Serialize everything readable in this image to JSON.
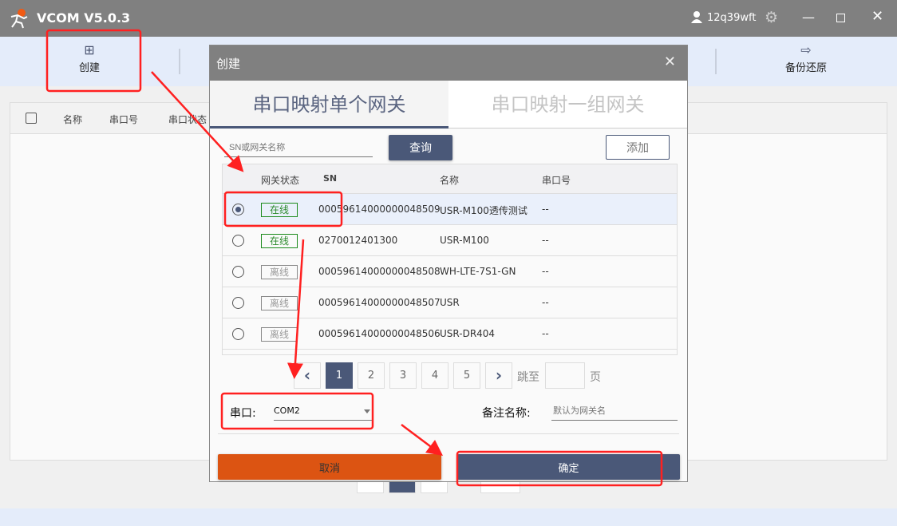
{
  "app": {
    "title": "VCOM V5.0.3",
    "user": "12q39wft"
  },
  "toolbar": {
    "create": "创建",
    "backup": "备份还原"
  },
  "main_table": {
    "headers": [
      "名称",
      "串口号",
      "串口状态"
    ]
  },
  "dialog": {
    "title": "创建",
    "tabs": [
      {
        "label": "串口映射单个网关",
        "active": true
      },
      {
        "label": "串口映射一组网关",
        "active": false
      }
    ],
    "search_placeholder": "SN或网关名称",
    "query_label": "查询",
    "add_label": "添加",
    "columns": [
      "网关状态",
      "SN",
      "名称",
      "串口号"
    ],
    "rows": [
      {
        "selected": true,
        "status": "在线",
        "online": true,
        "sn": "00059614000000048509",
        "name": "USR-M100透传测试",
        "port": "--"
      },
      {
        "selected": false,
        "status": "在线",
        "online": true,
        "sn": "0270012401300",
        "name": "USR-M100",
        "port": "--"
      },
      {
        "selected": false,
        "status": "离线",
        "online": false,
        "sn": "00059614000000048508",
        "name": "WH-LTE-7S1-GN",
        "port": "--"
      },
      {
        "selected": false,
        "status": "离线",
        "online": false,
        "sn": "00059614000000048507",
        "name": "USR",
        "port": "--"
      },
      {
        "selected": false,
        "status": "离线",
        "online": false,
        "sn": "00059614000000048506",
        "name": "USR-DR404",
        "port": "--"
      }
    ],
    "pagination": {
      "pages": [
        "1",
        "2",
        "3",
        "4",
        "5"
      ],
      "current": "1",
      "goto_label": "跳至",
      "page_suffix": "页"
    },
    "serial_label": "串口:",
    "serial_value": "COM2",
    "remark_label": "备注名称:",
    "remark_placeholder": "默认为网关名",
    "cancel_label": "取消",
    "confirm_label": "确定"
  },
  "colors": {
    "primary": "#4a5878",
    "cancel": "#dc5412",
    "online": "#1a8a1a",
    "annotation": "#ff2020"
  }
}
